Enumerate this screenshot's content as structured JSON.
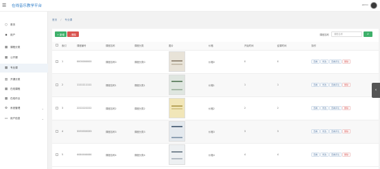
{
  "header": {
    "menu_icon": "hamburger-icon",
    "title": "在线音乐教学平台",
    "admin": "admin"
  },
  "sidebar": {
    "items": [
      {
        "icon": "home-icon",
        "label": "首页"
      },
      {
        "icon": "user-icon",
        "label": "用户"
      },
      {
        "icon": "grid-icon",
        "label": "课程分类"
      },
      {
        "icon": "grid-icon",
        "label": "公开课"
      },
      {
        "icon": "grid-icon",
        "label": "专业课"
      },
      {
        "icon": "chart-icon",
        "label": "开课分类"
      },
      {
        "icon": "grid-icon",
        "label": "在线课程"
      },
      {
        "icon": "grid-icon",
        "label": "在线作业"
      },
      {
        "icon": "gear-icon",
        "label": "系统管理"
      },
      {
        "icon": "id-card-icon",
        "label": "用户信息"
      }
    ]
  },
  "breadcrumb": {
    "home": "首页",
    "current": "专业课"
  },
  "toolbar": {
    "add_label": "+ 新增",
    "delete_label": "- 删除",
    "search_label": "课程名称",
    "search_placeholder": "课程名称"
  },
  "table": {
    "headers": [
      "",
      "索引",
      "课程编号",
      "课程名称",
      "课程分类",
      "图片",
      "价格",
      "开始时间",
      "结课时间",
      "操作"
    ],
    "rows": [
      {
        "index": "1",
        "code": "0000000000",
        "name": "课程名称0",
        "category": "课程分类0",
        "price": "价格0",
        "start": "0",
        "end": "0"
      },
      {
        "index": "2",
        "code": "1111111111",
        "name": "课程名称1",
        "category": "课程分类1",
        "price": "价格1",
        "start": "1",
        "end": "1"
      },
      {
        "index": "3",
        "code": "2222222222",
        "name": "课程名称2",
        "category": "课程分类2",
        "price": "价格2",
        "start": "2",
        "end": "2"
      },
      {
        "index": "4",
        "code": "3333333333",
        "name": "课程名称3",
        "category": "课程分类3",
        "price": "价格3",
        "start": "3",
        "end": "3"
      },
      {
        "index": "5",
        "code": "4444444444",
        "name": "课程名称4",
        "category": "课程分类4",
        "price": "价格4",
        "start": "4",
        "end": "4"
      }
    ],
    "ops": {
      "view": "查看",
      "edit": "修改",
      "comment": "查看评论",
      "delete": "删除"
    }
  },
  "colors": {
    "accent": "#2f7ec9",
    "green": "#3eb06a",
    "red": "#d9534f"
  }
}
